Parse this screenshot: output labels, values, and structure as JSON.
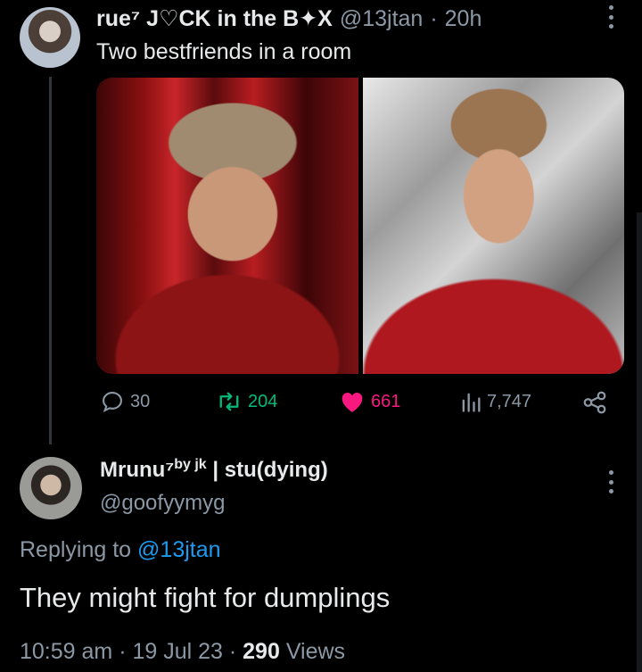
{
  "tweet1": {
    "author_name": "rue⁷ J♡CK in the B✦X",
    "handle": "@13jtan",
    "separator": "·",
    "time": "20h",
    "text": "Two bestfriends in a room",
    "replies": "30",
    "retweets": "204",
    "likes": "661",
    "views": "7,747"
  },
  "tweet2": {
    "author_name": "Mrunu⁷",
    "author_sup": "by jk",
    "author_suffix": " | stu(dying)",
    "handle": "@goofyymyg",
    "replying_prefix": "Replying to ",
    "replying_to": "@13jtan",
    "text": "They might fight for dumplings",
    "time": "10:59 am",
    "date": "19 Jul 23",
    "sep": " · ",
    "views_count": "290",
    "views_label": " Views"
  },
  "colors": {
    "background": "#000000",
    "text": "#e7e9ea",
    "muted": "#8b98a5",
    "retweet": "#00ba7c",
    "like": "#f91880",
    "link": "#1d9bf0"
  },
  "icons": [
    "more-icon",
    "reply-icon",
    "retweet-icon",
    "heart-icon",
    "views-icon",
    "share-icon"
  ]
}
